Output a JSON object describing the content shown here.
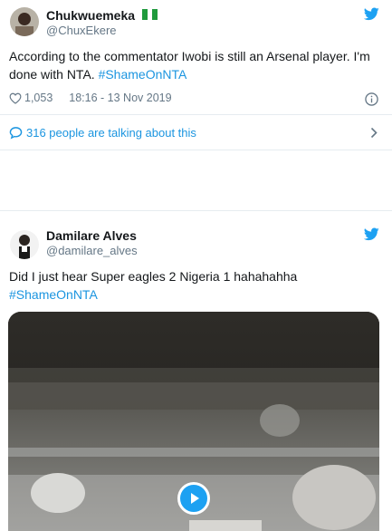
{
  "tweet1": {
    "name": "Chukwuemeka",
    "handle": "@ChuxEkere",
    "flag": "nigeria-flag",
    "text": "According to the commentator Iwobi is still an Arsenal player. I'm done with NTA.",
    "hashtag": "#ShameOnNTA",
    "likes": "1,053",
    "timestamp": "18:16 - 13 Nov 2019",
    "talking": "316 people are talking about this"
  },
  "tweet2": {
    "name": "Damilare Alves",
    "handle": "@damilare_alves",
    "text": "Did I just hear Super eagles 2 Nigeria 1 hahahahha",
    "hashtag": "#ShameOnNTA"
  },
  "colors": {
    "accent": "#1da1f2",
    "link": "#1b95e0",
    "muted": "#657786"
  }
}
